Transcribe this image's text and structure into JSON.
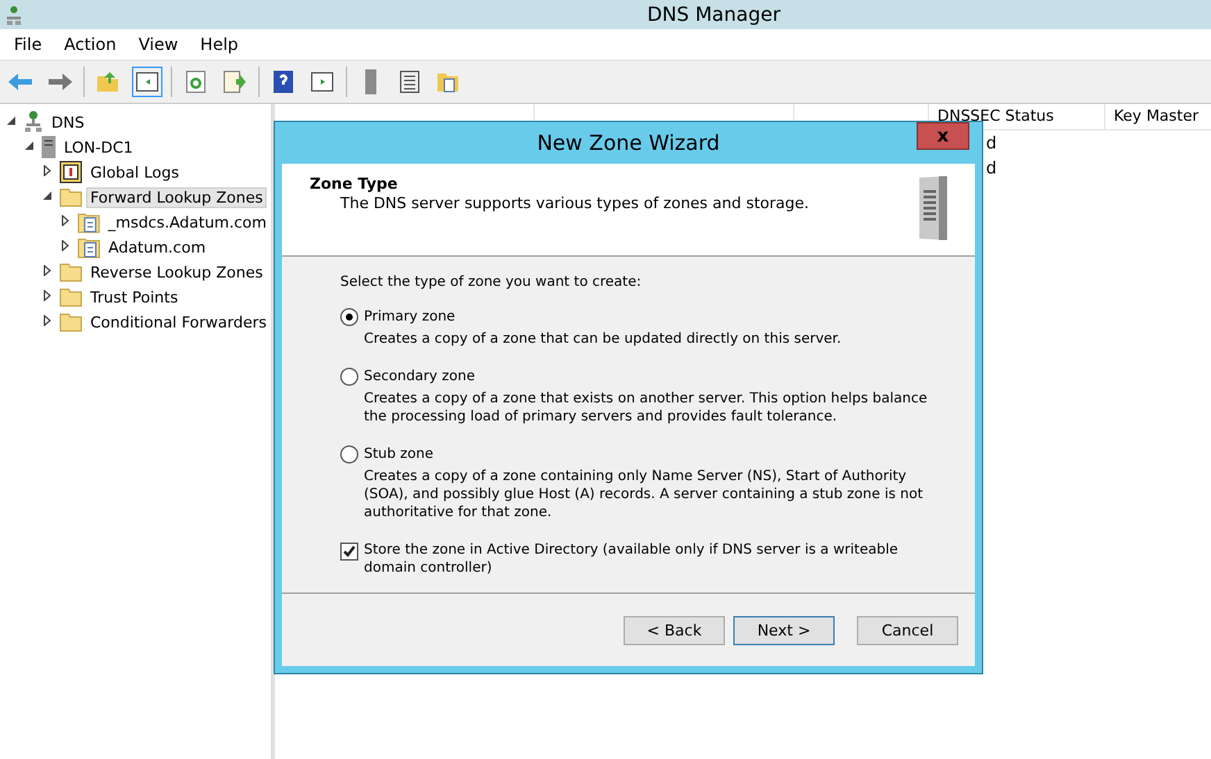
{
  "window": {
    "title": "DNS Manager"
  },
  "menu": [
    "File",
    "Action",
    "View",
    "Help"
  ],
  "tree": [
    {
      "label": "DNS",
      "kind": "network",
      "expanded": true,
      "selected": false,
      "children": [
        {
          "label": "LON-DC1",
          "kind": "server",
          "expanded": true,
          "selected": false,
          "children": [
            {
              "label": "Global Logs",
              "kind": "log",
              "expanded": false,
              "selected": false
            },
            {
              "label": "Forward Lookup Zones",
              "kind": "folder",
              "expanded": true,
              "selected": true,
              "children": [
                {
                  "label": "_msdcs.Adatum.com",
                  "kind": "zone",
                  "expanded": false,
                  "selected": false
                },
                {
                  "label": "Adatum.com",
                  "kind": "zone",
                  "expanded": false,
                  "selected": false
                }
              ]
            },
            {
              "label": "Reverse Lookup Zones",
              "kind": "folder",
              "expanded": false,
              "selected": false
            },
            {
              "label": "Trust Points",
              "kind": "folder",
              "expanded": false,
              "selected": false
            },
            {
              "label": "Conditional Forwarders",
              "kind": "folder",
              "expanded": false,
              "selected": false
            }
          ]
        }
      ]
    }
  ],
  "table": {
    "columns": [
      "DNSSEC Status",
      "Key Master"
    ],
    "rows": [
      [
        "d"
      ],
      [
        "d"
      ]
    ]
  },
  "dialog": {
    "title": "New Zone Wizard",
    "close": "x",
    "heading": "Zone Type",
    "subheading": "The DNS server supports various types of zones and storage.",
    "prompt": "Select the type of zone you want to create:",
    "options": [
      {
        "label": "Primary zone",
        "description": "Creates a copy of a zone that can be updated directly on this server.",
        "selected": true
      },
      {
        "label": "Secondary zone",
        "description": "Creates a copy of a zone that exists on another server. This option helps balance the processing load of primary servers and provides fault tolerance.",
        "selected": false
      },
      {
        "label": "Stub zone",
        "description": "Creates a copy of a zone containing only Name Server (NS), Start of Authority (SOA), and possibly glue Host (A) records. A server containing a stub zone is not authoritative for that zone.",
        "selected": false
      }
    ],
    "store": {
      "label": "Store the zone in Active Directory (available only if DNS server is a writeable domain controller)",
      "checked": true
    },
    "buttons": [
      {
        "label": "< Back",
        "default": false
      },
      {
        "label": "Next >",
        "default": true
      },
      {
        "label": "Cancel",
        "default": false
      }
    ]
  }
}
